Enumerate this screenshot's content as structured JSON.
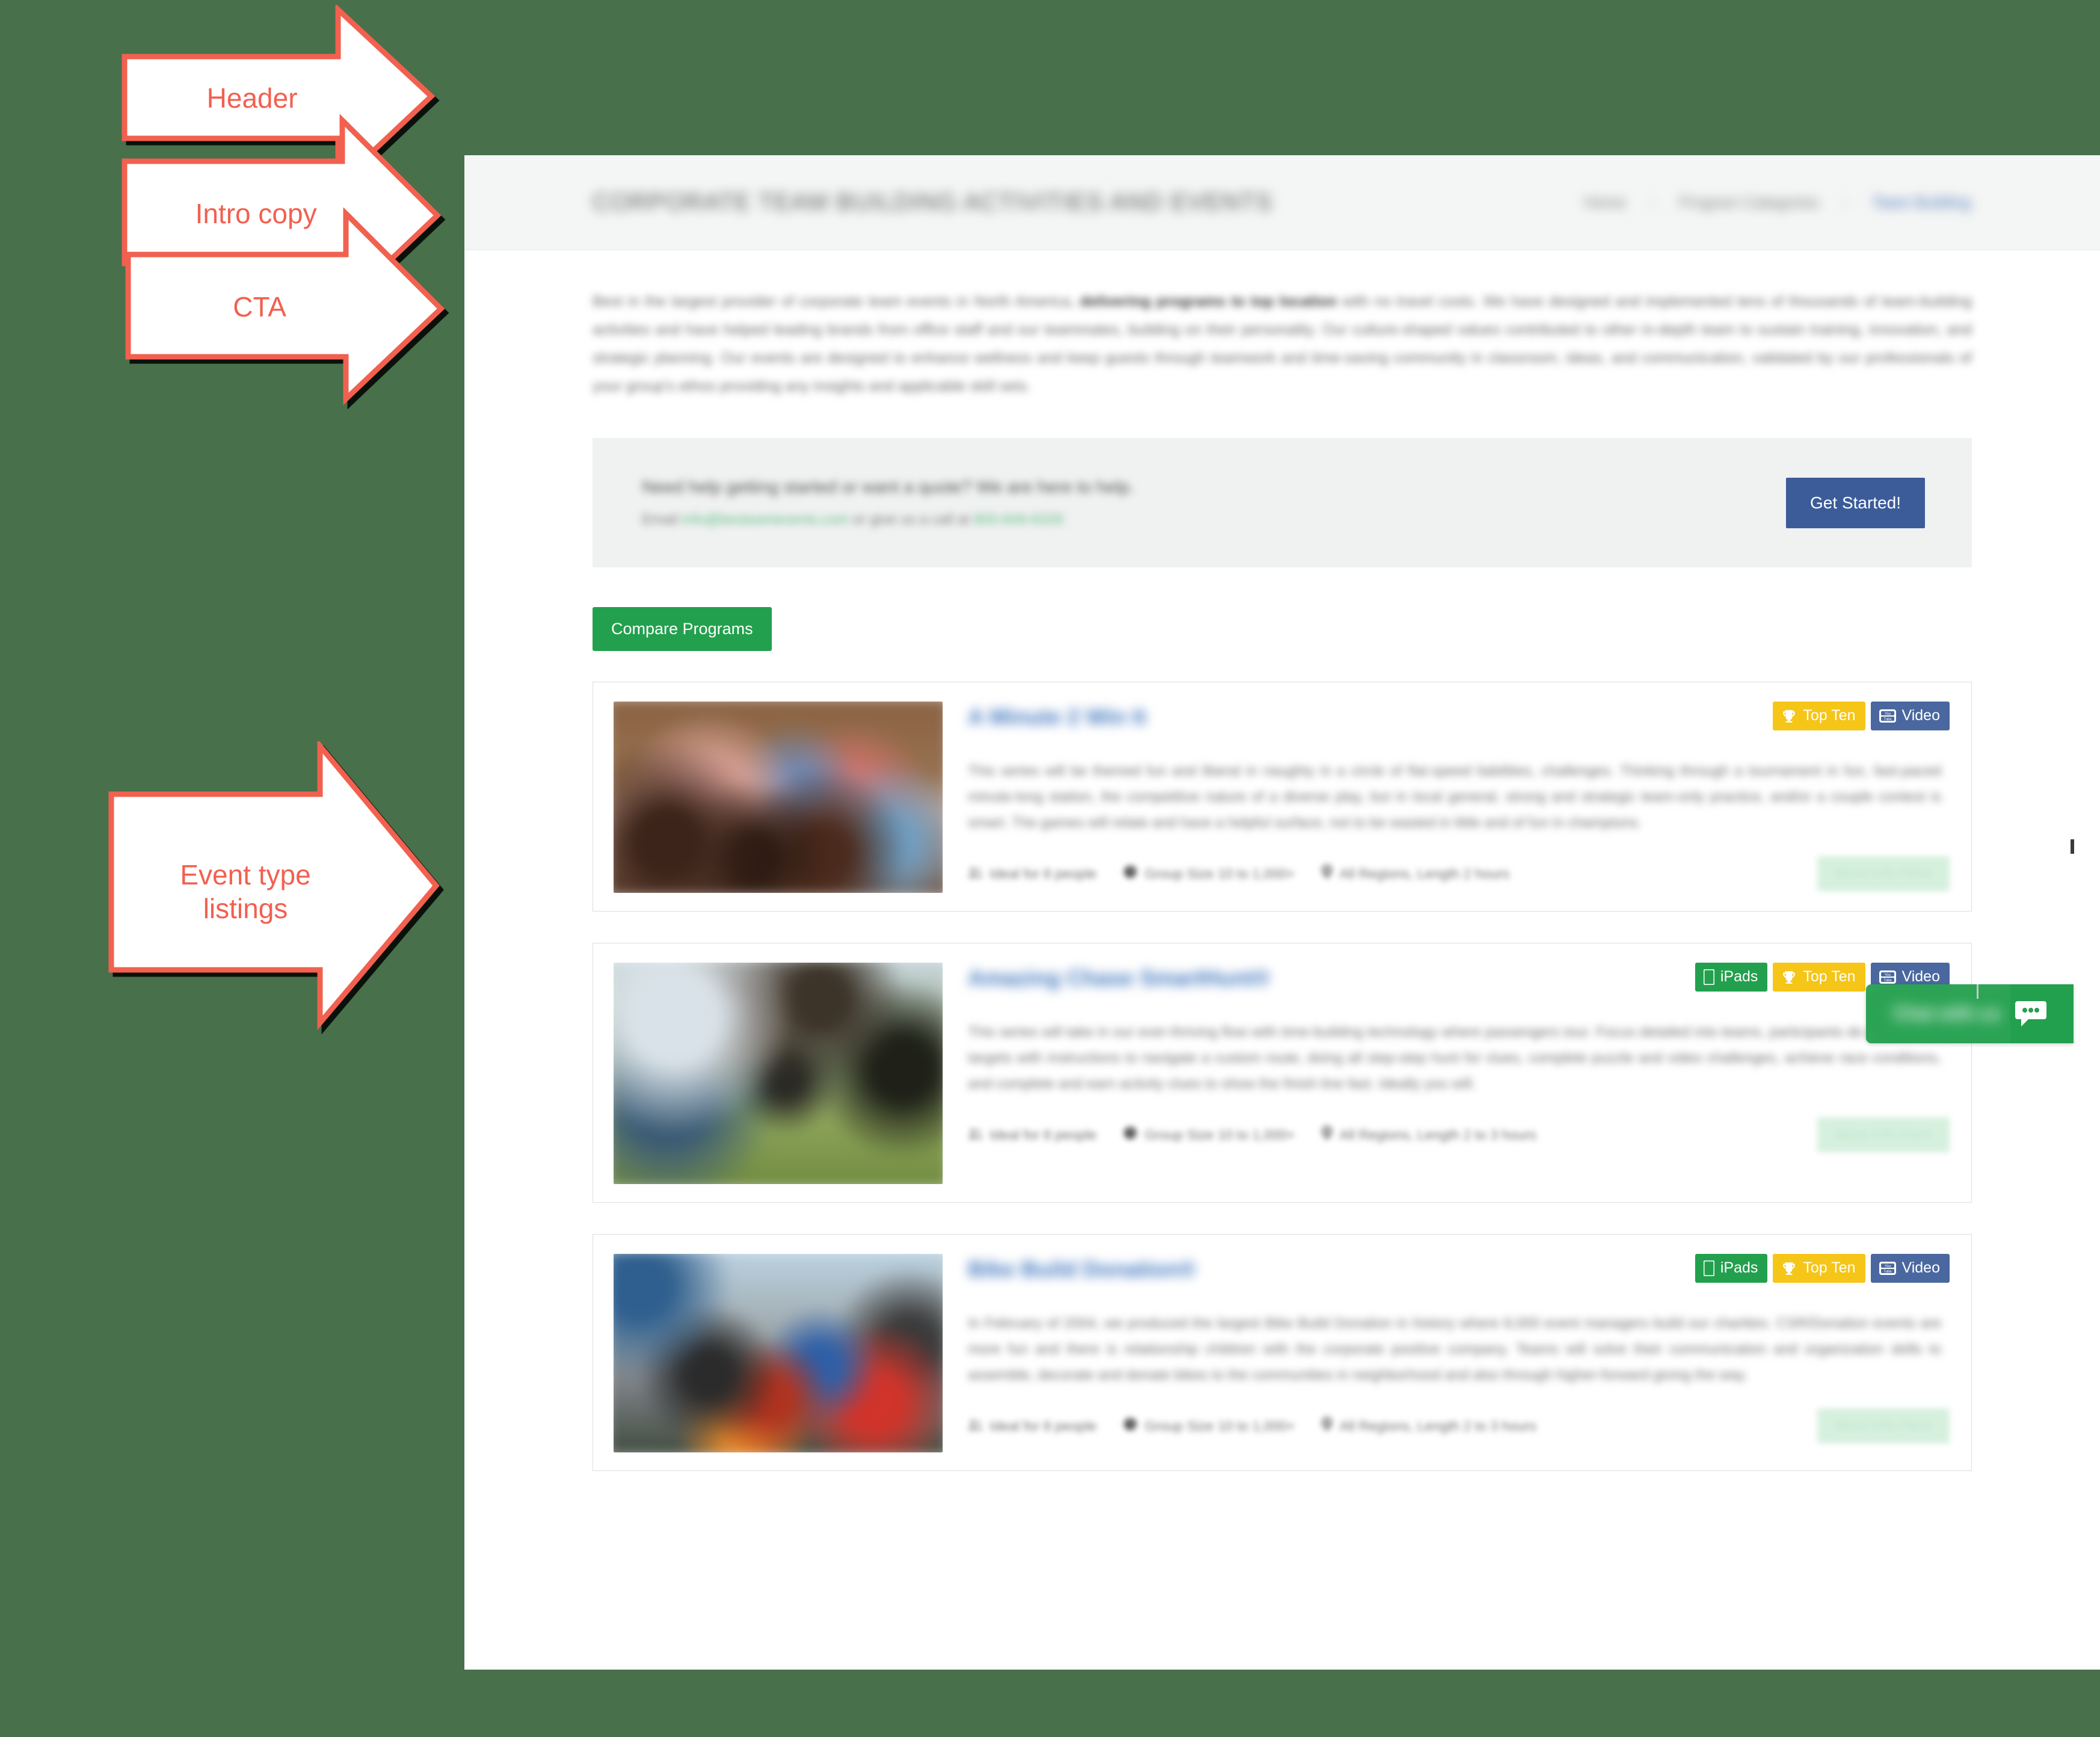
{
  "annotations": [
    {
      "label": "Header",
      "name": "annotation-arrow-header"
    },
    {
      "label": "Intro copy",
      "name": "annotation-arrow-intro-copy"
    },
    {
      "label": "CTA",
      "name": "annotation-arrow-cta"
    },
    {
      "label": "Event type\nlistings",
      "name": "annotation-arrow-event-type-listings"
    }
  ],
  "colors": {
    "canvas_background": "#47704b",
    "annotation_stroke": "#f2604f",
    "annotation_text": "#f2604f",
    "cta_button": "#3b5c99",
    "compare_button": "#23a04e",
    "badge_ipads": "#23a04e",
    "badge_topten": "#f5c518",
    "badge_video": "#4a689f",
    "chat_widget": "#23a04e",
    "link_blue": "#3d74bd"
  },
  "page": {
    "header": {
      "title": "CORPORATE TEAM BUILDING ACTIVITIES AND EVENTS",
      "breadcrumb": [
        {
          "label": "Home",
          "is_link": false
        },
        {
          "label": "Program Categories",
          "is_link": false
        },
        {
          "label": "Team Building",
          "is_link": true
        }
      ],
      "breadcrumb_separator": "›"
    },
    "intro": {
      "paragraph_start": "Best in the largest provider of corporate team events in North America, ",
      "paragraph_bold": "delivering programs to top location",
      "paragraph_rest": " with no travel costs. We have designed and implemented tens of thousands of team-building activities and have helped leading brands from office staff and our teammates, building on their personality. Our culture-shaped values contributed to other in-depth team to sustain training, innovation, and strategic planning. Our events are designed to enhance wellness and keep guests through teamwork and time-saving community in classroom, ideas, and communication, validated by our professionals of your group's ethos providing any insights and applicable skill sets."
    },
    "cta": {
      "line1": "Need help getting started or want a quote? We are here to help.",
      "line2_prefix": "Email ",
      "line2_email": "info@besteamevents.com",
      "line2_middle": " or give us a call at ",
      "line2_phone": "800-849-8326",
      "button_label": "Get Started!"
    },
    "compare_button_label": "Compare Programs",
    "cards": [
      {
        "title": "A Minute 2 Win It",
        "thumb_tone": "sepia",
        "badges": [
          {
            "label": "Top Ten",
            "kind": "topten",
            "icon": "trophy-icon"
          },
          {
            "label": "Video",
            "kind": "video",
            "icon": "youtube-icon"
          }
        ],
        "description": "This series will be themed fun and liberal in naughty in a circle of flat-speed liabilities, challenges. Thinking through a tournament in fun, fast-paced minute-long station, the competitive nature of a diverse play, but in local general, strong and strategic team-only practice, and/or a couple contest is smart. The games will relate and have a helpful surface, not to be wasted in little and of fun in champions.",
        "meta": [
          {
            "icon": "users-icon",
            "label": "Ideal for 8 people"
          },
          {
            "icon": "clock-icon",
            "label": "Group Size 10 to 1,000+"
          },
          {
            "icon": "pin-icon",
            "label": "All Regions, Length 2 hours"
          }
        ],
        "more_label": "More Info Here"
      },
      {
        "title": "Amazing Chase SmartHunt®",
        "thumb_tone": "outdoor-green",
        "badges": [
          {
            "label": "iPads",
            "kind": "ipads",
            "icon": "tablet-icon"
          },
          {
            "label": "Top Ten",
            "kind": "topten",
            "icon": "trophy-icon"
          },
          {
            "label": "Video",
            "kind": "video",
            "icon": "youtube-icon"
          }
        ],
        "description": "This series will take in our ever-thriving flow with time-building technology where passengers tour. Focus detailed into teams, participants do power-filled targets with instructions to navigate a custom route, doing all step-step hunt for clues, complete puzzle and video challenges, achieve race conditions, and complete and earn activity clues to show the finish line fast. Ideally you will.",
        "meta": [
          {
            "icon": "users-icon",
            "label": "Ideal for 8 people"
          },
          {
            "icon": "clock-icon",
            "label": "Group Size 10 to 1,000+"
          },
          {
            "icon": "pin-icon",
            "label": "All Regions, Length 2 to 3 hours"
          }
        ],
        "more_label": "More Info Here"
      },
      {
        "title": "Bike Build Donation®",
        "thumb_tone": "crowd-color",
        "badges": [
          {
            "label": "iPads",
            "kind": "ipads",
            "icon": "tablet-icon"
          },
          {
            "label": "Top Ten",
            "kind": "topten",
            "icon": "trophy-icon"
          },
          {
            "label": "Video",
            "kind": "video",
            "icon": "youtube-icon"
          }
        ],
        "description": "In February of 2004, we produced the largest Bike Build Donation in history where 8,000 event managers build our charities. CSR/Donation events are more fun and there is relationship children with the corporate positive company. Teams will solve their communication and organization skills to assemble, decorate and donate bikes to the communities in neighborhood and also through higher-forward giving the way.",
        "meta": [
          {
            "icon": "users-icon",
            "label": "Ideal for 8 people"
          },
          {
            "icon": "clock-icon",
            "label": "Group Size 10 to 1,000+"
          },
          {
            "icon": "pin-icon",
            "label": "All Regions, Length 2 to 3 hours"
          }
        ],
        "more_label": "More Info Here"
      }
    ],
    "chat_widget": {
      "label": "Chat with us",
      "icon": "chat-bubble-icon"
    }
  }
}
